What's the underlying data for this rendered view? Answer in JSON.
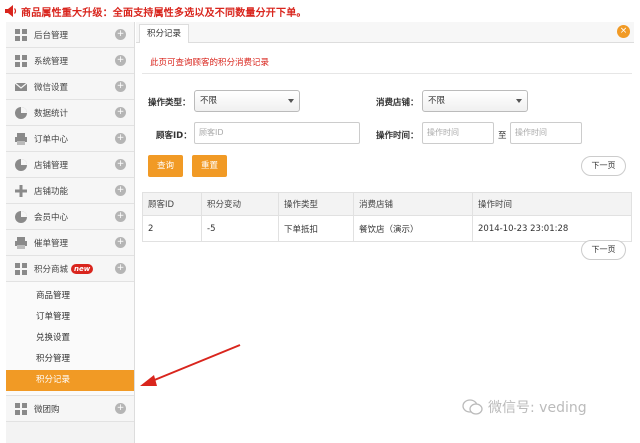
{
  "banner": {
    "text": "商品属性重大升级：全面支持属性多选以及不同数量分开下单。"
  },
  "sidebar": {
    "items": [
      {
        "label": "后台管理",
        "icon": "grid-icon"
      },
      {
        "label": "系统管理",
        "icon": "grid-icon"
      },
      {
        "label": "微信设置",
        "icon": "mail-icon"
      },
      {
        "label": "数据统计",
        "icon": "pie-icon"
      },
      {
        "label": "订单中心",
        "icon": "printer-icon"
      },
      {
        "label": "店铺管理",
        "icon": "pie-icon"
      },
      {
        "label": "店铺功能",
        "icon": "plus-icon"
      },
      {
        "label": "会员中心",
        "icon": "pie-icon"
      },
      {
        "label": "催单管理",
        "icon": "printer-icon"
      },
      {
        "label": "积分商城",
        "icon": "grid-icon",
        "badge": "new"
      }
    ],
    "subitems": [
      "商品管理",
      "订单管理",
      "兑换设置",
      "积分管理",
      "积分记录"
    ],
    "active_sub": "积分记录",
    "after": {
      "label": "微团购",
      "icon": "grid-icon"
    }
  },
  "tab": {
    "label": "积分记录",
    "close": "×"
  },
  "notice": "此页可查询顾客的积分消费记录",
  "filters": {
    "op_type_label": "操作类型：",
    "op_type_value": "不限",
    "store_label": "消费店铺：",
    "store_value": "不限",
    "customer_label": "顾客ID：",
    "customer_placeholder": "顾客ID",
    "time_label": "操作时间：",
    "time_placeholder_start": "操作时间",
    "time_sep": "至",
    "time_placeholder_end": "操作时间"
  },
  "buttons": {
    "query": "查询",
    "reset": "重置",
    "next_top": "下一页",
    "next_bottom": "下一页"
  },
  "table": {
    "headers": [
      "顾客ID",
      "积分变动",
      "操作类型",
      "消费店铺",
      "操作时间"
    ],
    "rows": [
      [
        "2",
        "-5",
        "下单抵扣",
        "餐饮店（演示）",
        "2014-10-23 23:01:28"
      ]
    ]
  },
  "watermark": "微信号: veding",
  "colors": {
    "accent": "#f19a25",
    "alert": "#d9251d"
  }
}
